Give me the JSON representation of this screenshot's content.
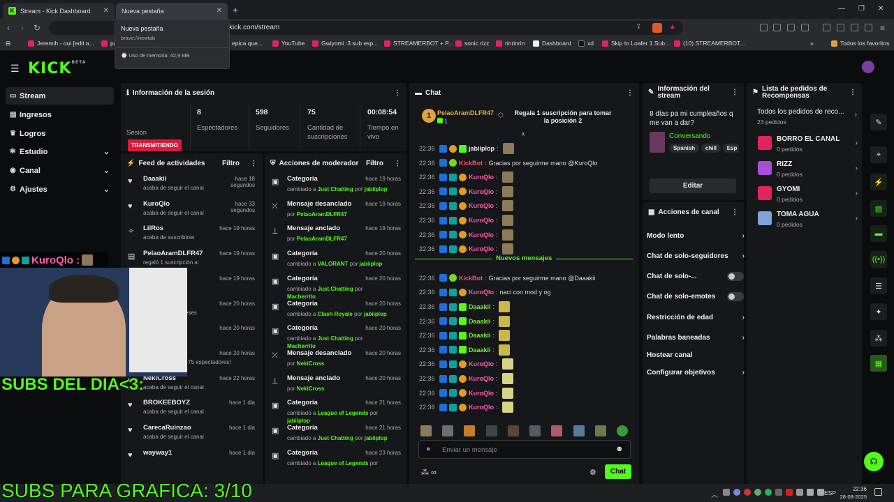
{
  "browser": {
    "tabs": [
      {
        "label": "Stream - Kick Dashboard"
      },
      {
        "label": "Nueva pestaña"
      }
    ],
    "url": "kick.com/stream",
    "bookmarks": [
      "Jeremih - oui [edit a...",
      "pa",
      "epica que...",
      "YouTube",
      "Gwiyomi :3 sub esp...",
      "STREAMERBOT + P...",
      "sonic rizz",
      "rinrinrin",
      "Dashboard",
      "xd",
      "Skip to Loafer 1 Sub...",
      "(10) STREAMERBOT...",
      "Todos los favoritos"
    ],
    "popup": {
      "title": "Nueva pestaña",
      "url": "brave://newtab",
      "memory": "Uso de memoria: 42,9 MB"
    }
  },
  "sidebar": {
    "items": [
      {
        "label": "Stream",
        "icon": "screen-icon"
      },
      {
        "label": "Ingresos",
        "icon": "money-icon"
      },
      {
        "label": "Logros",
        "icon": "trophy-icon"
      },
      {
        "label": "Estudio",
        "icon": "studio-icon"
      },
      {
        "label": "Canal",
        "icon": "channel-icon"
      },
      {
        "label": "Ajustes",
        "icon": "gear-icon"
      }
    ]
  },
  "session": {
    "title": "Información de la sesión",
    "live_badge": "TRANSMITIENDO",
    "session_label": "Sesión",
    "stats": [
      {
        "value": "8",
        "label": "Espectadores"
      },
      {
        "value": "598",
        "label": "Seguidores"
      },
      {
        "value": "75",
        "label": "Cantidad de suscripciones"
      },
      {
        "value": "00:08:54",
        "label": "Tiempo en vivo"
      }
    ]
  },
  "feed": {
    "title": "Feed de actividades",
    "filter": "Filtro",
    "items": [
      {
        "name": "Daaakii",
        "time": "hace 18 segundos",
        "desc": "acaba de seguir el canal"
      },
      {
        "name": "KuroQlo",
        "time": "hace 33 segundos",
        "desc": "acaba de seguir el canal"
      },
      {
        "name": "LilRos",
        "time": "hace 19 horas",
        "desc": "acaba de suscribirse"
      },
      {
        "name": "PelaoAramDLFR47",
        "time": "hace 19 horas",
        "desc": "regaló 1 suscripción a:"
      },
      {
        "name": "",
        "time": "hace 19 horas",
        "desc": ""
      },
      {
        "name": "",
        "time": "hace 20 horas",
        "desc": "ritos durante 3 meses"
      },
      {
        "name": "",
        "time": "hace 20 horas",
        "desc": "o el canal"
      },
      {
        "name": "",
        "time": "hace 20 horas",
        "desc": "¡ha hosteado con 75 espectadores!"
      },
      {
        "name": "NekiCross",
        "time": "hace 22 horas",
        "desc": "acaba de seguir el canal"
      },
      {
        "name": "BROKEEBOYZ",
        "time": "hace 1 dia",
        "desc": "acaba de seguir el canal"
      },
      {
        "name": "CarecaRuinzao",
        "time": "hace 1 dia",
        "desc": "acaba de seguir el canal"
      },
      {
        "name": "wayway1",
        "time": "hace 1 dia",
        "desc": ""
      }
    ]
  },
  "mod": {
    "title": "Acciones de moderador",
    "filter": "Filtro",
    "items": [
      {
        "name": "Categoría",
        "time": "hace 19 horas",
        "pre": "cambiado a ",
        "hl": "Just Chatting",
        "mid": " por ",
        "by": "jabiiplop"
      },
      {
        "name": "Mensaje desanclado",
        "time": "hace 19 horas",
        "pre": "por ",
        "hl": "",
        "mid": "",
        "by": "PelaoAramDLFR47"
      },
      {
        "name": "Mensaje anclado",
        "time": "hace 19 horas",
        "pre": "por ",
        "hl": "",
        "mid": "",
        "by": "PelaoAramDLFR47"
      },
      {
        "name": "Categoría",
        "time": "hace 20 horas",
        "pre": "cambiado a ",
        "hl": "VALORANT",
        "mid": " por ",
        "by": "jabiiplop"
      },
      {
        "name": "Categoría",
        "time": "hace 20 horas",
        "pre": "cambiado a ",
        "hl": "Just Chatting",
        "mid": " por ",
        "by": "Macherrito"
      },
      {
        "name": "Categoría",
        "time": "hace 20 horas",
        "pre": "cambiado a ",
        "hl": "Clash Royale",
        "mid": " por ",
        "by": "jabiiplop"
      },
      {
        "name": "Categoría",
        "time": "hace 20 horas",
        "pre": "cambiado a ",
        "hl": "Just Chatting",
        "mid": " por ",
        "by": "Macherrito"
      },
      {
        "name": "Mensaje desanclado",
        "time": "hace 20 horas",
        "pre": "por ",
        "hl": "",
        "mid": "",
        "by": "NekiCross"
      },
      {
        "name": "Mensaje anclado",
        "time": "hace 20 horas",
        "pre": "por ",
        "hl": "",
        "mid": "",
        "by": "NekiCross"
      },
      {
        "name": "Categoría",
        "time": "hace 21 horas",
        "pre": "cambiado a ",
        "hl": "League of Legends",
        "mid": " por ",
        "by": "jabiiplop"
      },
      {
        "name": "Categoría",
        "time": "hace 21 horas",
        "pre": "cambiado a ",
        "hl": "Just Chatting",
        "mid": " por ",
        "by": "jabiiplop"
      },
      {
        "name": "Categoría",
        "time": "hace 23 horas",
        "pre": "cambiado a ",
        "hl": "League of Legends",
        "mid": " por",
        "by": ""
      }
    ]
  },
  "chat": {
    "title": "Chat",
    "pinned_user": "PelaoAramDLFR47",
    "pinned_count": "1",
    "pinned_text": "Regala 1 suscripción para tomar la posición 2",
    "new_messages": "Nuevos mensajes",
    "lines": [
      {
        "ts": "22:36",
        "user": "jabiiplop",
        "cls": "u-white",
        "msg": "",
        "emote": true
      },
      {
        "ts": "22:36",
        "user": "KickBot",
        "cls": "u-red",
        "msg": "Gracias por seguirme mano @KuroQlo",
        "emote": false
      },
      {
        "ts": "22:36",
        "user": "KuroQlo",
        "cls": "u-pink",
        "msg": "",
        "emote": true
      },
      {
        "ts": "22:36",
        "user": "KuroQlo",
        "cls": "u-pink",
        "msg": "",
        "emote": true
      },
      {
        "ts": "22:36",
        "user": "KuroQlo",
        "cls": "u-pink",
        "msg": "",
        "emote": true
      },
      {
        "ts": "22:36",
        "user": "KuroQlo",
        "cls": "u-pink",
        "msg": "",
        "emote": true
      },
      {
        "ts": "22:36",
        "user": "KuroQlo",
        "cls": "u-pink",
        "msg": "",
        "emote": true
      },
      {
        "ts": "22:36",
        "user": "KuroQlo",
        "cls": "u-pink",
        "msg": "",
        "emote": true
      },
      {
        "ts": "22:36",
        "user": "KickBot",
        "cls": "u-red",
        "msg": "Gracias por seguirme mano @Daaakii",
        "emote": false
      },
      {
        "ts": "22:36",
        "user": "KuroQlo",
        "cls": "u-pink",
        "msg": "naci con mod y og",
        "emote": false
      },
      {
        "ts": "22:36",
        "user": "Daaakii",
        "cls": "u-green",
        "msg": "",
        "emote": true
      },
      {
        "ts": "22:36",
        "user": "Daaakii",
        "cls": "u-green",
        "msg": "",
        "emote": true
      },
      {
        "ts": "22:36",
        "user": "Daaakii",
        "cls": "u-green",
        "msg": "",
        "emote": true
      },
      {
        "ts": "22:36",
        "user": "Daaakii",
        "cls": "u-green",
        "msg": "",
        "emote": true
      },
      {
        "ts": "22:36",
        "user": "KuroQlo",
        "cls": "u-pink",
        "msg": "",
        "emote": true
      },
      {
        "ts": "22:36",
        "user": "KuroQlo",
        "cls": "u-pink",
        "msg": "",
        "emote": true
      },
      {
        "ts": "22:36",
        "user": "KuroQlo",
        "cls": "u-pink",
        "msg": "",
        "emote": true
      },
      {
        "ts": "22:36",
        "user": "KuroQlo",
        "cls": "u-pink",
        "msg": "",
        "emote": true
      }
    ],
    "input_placeholder": "Enviar un mensaje",
    "send": "Chat"
  },
  "stream_info": {
    "title": "Información del stream",
    "stream_title": "8 días pa mi cumpleaños q me van a dar?",
    "category": "Conversando",
    "tags": [
      "Spanish",
      "chill",
      "Esp"
    ],
    "edit": "Editar"
  },
  "channel_actions": {
    "title": "Acciones de canal",
    "items": [
      {
        "label": "Modo lento",
        "type": "chev"
      },
      {
        "label": "Chat de solo-seguidores",
        "type": "chev"
      },
      {
        "label": "Chat de solo-...",
        "type": "toggle"
      },
      {
        "label": "Chat de solo-emotes",
        "type": "toggle"
      },
      {
        "label": "Restricción de edad",
        "type": "chev"
      },
      {
        "label": "Palabras baneadas",
        "type": "chev"
      },
      {
        "label": "Hostear canal",
        "type": "none"
      },
      {
        "label": "Configurar objetivos",
        "type": "chev"
      }
    ]
  },
  "rewards": {
    "title": "Lista de pedidos de Recompensas",
    "all_label": "Todos los pedidos de reco...",
    "all_count": "23 pedidos",
    "items": [
      {
        "title": "BORRO EL CANAL",
        "count": "0 pedidos",
        "color": "#e0245e"
      },
      {
        "title": "RIZZ",
        "count": "0 pedidos",
        "color": "#a84fd8"
      },
      {
        "title": "GYOMI",
        "count": "0 pedidos",
        "color": "#e0245e"
      },
      {
        "title": "TOMA AGUA",
        "count": "0 pedidos",
        "color": "#7ea4d8"
      }
    ]
  },
  "overlay": {
    "cam_user": "KuroQlo :",
    "subs_day": "SUBS DEL DIA<3:",
    "subs_goal": "SUBS PARA GRAFICA: 3/10"
  },
  "taskbar": {
    "lang": "ESP",
    "time": "22:36",
    "date": "28-08-2025"
  },
  "colors": {
    "accent": "#53fc18",
    "live": "#d81b3f"
  }
}
